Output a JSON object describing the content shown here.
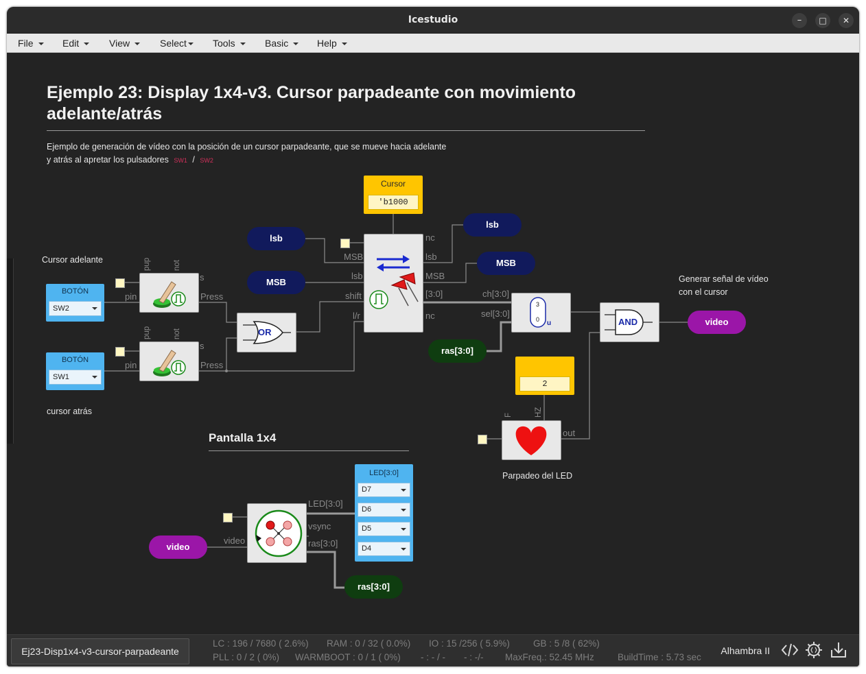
{
  "window": {
    "title": "Icestudio",
    "min": "–",
    "max": "□",
    "close": "✕"
  },
  "menu": [
    "File",
    "Edit",
    "View",
    "Select",
    "Tools",
    "Basic",
    "Help"
  ],
  "header": {
    "title_line1": "Ejemplo 23: Display 1x4-v3. Cursor parpadeante con movimiento",
    "title_line2": "adelante/atrás",
    "desc_line1": "Ejemplo de generación de vídeo con la posición de un cursor parpadeante, que se mueve hacia adelante",
    "desc_line2": "y atrás al apretar los pulsadores",
    "sw1": "SW1",
    "slash": "/",
    "sw2": "SW2"
  },
  "comments": {
    "cursor_adelante": "Cursor adelante",
    "cursor_atras": "cursor atrás",
    "generar1": "Generar señal de vídeo",
    "generar2": "con el cursor",
    "parpadeo": "Parpadeo del LED"
  },
  "section_pantalla": "Pantalla 1x4",
  "buttons": [
    {
      "title": "BOTÓN",
      "value": "SW2"
    },
    {
      "title": "BOTÓN",
      "value": "SW1"
    }
  ],
  "cursor_const": {
    "title": "Cursor",
    "value": "'b1000"
  },
  "const2": {
    "value": "2"
  },
  "led_block": {
    "title": "LED[3:0]",
    "options": [
      "D7",
      "D6",
      "D5",
      "D4"
    ]
  },
  "pills": {
    "lsb_left": "lsb",
    "msb_left": "MSB",
    "lsb_right": "lsb",
    "msb_right": "MSB",
    "video_right": "video",
    "ras_mid": "ras[3:0]",
    "video_left": "video",
    "ras_bottom": "ras[3:0]"
  },
  "gates": {
    "or": "OR",
    "and": "AND"
  },
  "ports": {
    "up": "pup",
    "not": "not",
    "pin": "pin",
    "press": "Press",
    "s": "s",
    "msb": "MSB",
    "lsb": "lsb",
    "shift": "shift",
    "lr": "l/r",
    "nc": "nc",
    "out_lsb": "lsb",
    "out_msb": "MSB",
    "out_30": "[3:0]",
    "ch": "ch[3:0]",
    "sel": "sel[3:0]",
    "mux3": "3",
    "mux0": "0",
    "muxu": "u",
    "f": "F",
    "hz": "HZ",
    "out": "out",
    "led30": "LED[3:0]",
    "vsync": "vsync",
    "ras": "ras[3:0]",
    "video": "video"
  },
  "status": {
    "tab": "Ej23-Disp1x4-v3-cursor-parpadeante",
    "lc": "LC : 196 / 7680 ( 2.6%)",
    "ram": "RAM : 0 / 32 ( 0.0%)",
    "io": "IO :  15 /256  ( 5.9%)",
    "gb": "GB :  5 /8  ( 62%)",
    "pll": "PLL : 0 / 2 ( 0%)",
    "warmboot": "WARMBOOT : 0 / 1 ( 0%)",
    "dash1": "- : - / -",
    "dash2": "- :  -/-",
    "maxfreq": "MaxFreq.:  52.45 MHz",
    "buildtime": "BuildTime :   5.73 sec",
    "board": "Alhambra II"
  },
  "colors": {
    "navy": "#111a5c",
    "purple": "#9b16a8",
    "green": "#0f3d10",
    "yellow": "#ffc500",
    "blue": "#4fb4f0"
  }
}
